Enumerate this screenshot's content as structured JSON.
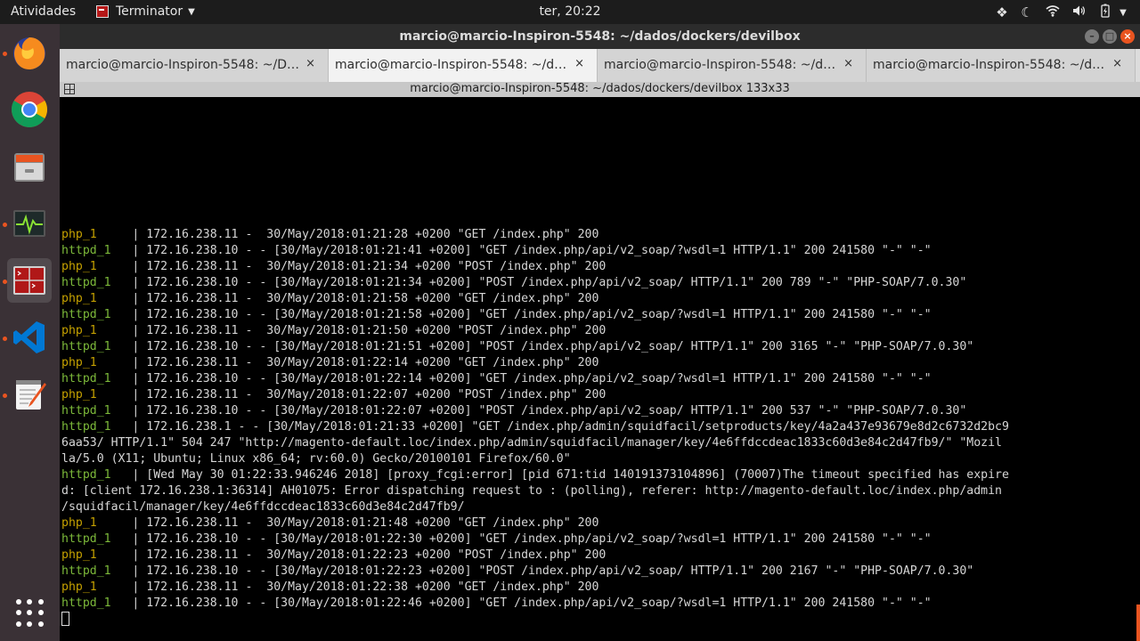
{
  "topbar": {
    "activities": "Atividades",
    "app_name": "Terminator",
    "clock": "ter, 20:22"
  },
  "window": {
    "title": "marcio@marcio-Inspiron-5548: ~/dados/dockers/devilbox"
  },
  "tabs": [
    {
      "label": "marcio@marcio-Inspiron-5548: ~/Do...",
      "active": false
    },
    {
      "label": "marcio@marcio-Inspiron-5548: ~/da...",
      "active": true
    },
    {
      "label": "marcio@marcio-Inspiron-5548: ~/da...",
      "active": false
    },
    {
      "label": "marcio@marcio-Inspiron-5548: ~/da...",
      "active": false
    }
  ],
  "tab_close": "×",
  "terminal": {
    "header": "marcio@marcio-Inspiron-5548: ~/dados/dockers/devilbox 133x33",
    "lines": [
      {
        "svc": "php_1     ",
        "text": "| 172.16.238.11 -  30/May/2018:01:21:28 +0200 \"GET /index.php\" 200"
      },
      {
        "svc": "httpd_1   ",
        "text": "| 172.16.238.10 - - [30/May/2018:01:21:41 +0200] \"GET /index.php/api/v2_soap/?wsdl=1 HTTP/1.1\" 200 241580 \"-\" \"-\""
      },
      {
        "svc": "php_1     ",
        "text": "| 172.16.238.11 -  30/May/2018:01:21:34 +0200 \"POST /index.php\" 200"
      },
      {
        "svc": "httpd_1   ",
        "text": "| 172.16.238.10 - - [30/May/2018:01:21:34 +0200] \"POST /index.php/api/v2_soap/ HTTP/1.1\" 200 789 \"-\" \"PHP-SOAP/7.0.30\""
      },
      {
        "svc": "php_1     ",
        "text": "| 172.16.238.11 -  30/May/2018:01:21:58 +0200 \"GET /index.php\" 200"
      },
      {
        "svc": "httpd_1   ",
        "text": "| 172.16.238.10 - - [30/May/2018:01:21:58 +0200] \"GET /index.php/api/v2_soap/?wsdl=1 HTTP/1.1\" 200 241580 \"-\" \"-\""
      },
      {
        "svc": "php_1     ",
        "text": "| 172.16.238.11 -  30/May/2018:01:21:50 +0200 \"POST /index.php\" 200"
      },
      {
        "svc": "httpd_1   ",
        "text": "| 172.16.238.10 - - [30/May/2018:01:21:51 +0200] \"POST /index.php/api/v2_soap/ HTTP/1.1\" 200 3165 \"-\" \"PHP-SOAP/7.0.30\""
      },
      {
        "svc": "php_1     ",
        "text": "| 172.16.238.11 -  30/May/2018:01:22:14 +0200 \"GET /index.php\" 200"
      },
      {
        "svc": "httpd_1   ",
        "text": "| 172.16.238.10 - - [30/May/2018:01:22:14 +0200] \"GET /index.php/api/v2_soap/?wsdl=1 HTTP/1.1\" 200 241580 \"-\" \"-\""
      },
      {
        "svc": "php_1     ",
        "text": "| 172.16.238.11 -  30/May/2018:01:22:07 +0200 \"POST /index.php\" 200"
      },
      {
        "svc": "httpd_1   ",
        "text": "| 172.16.238.10 - - [30/May/2018:01:22:07 +0200] \"POST /index.php/api/v2_soap/ HTTP/1.1\" 200 537 \"-\" \"PHP-SOAP/7.0.30\""
      },
      {
        "svc": "httpd_1   ",
        "text": "| 172.16.238.1 - - [30/May/2018:01:21:33 +0200] \"GET /index.php/admin/squidfacil/setproducts/key/4a2a437e93679e8d2c6732d2bc9"
      },
      {
        "svc": "",
        "text": "6aa53/ HTTP/1.1\" 504 247 \"http://magento-default.loc/index.php/admin/squidfacil/manager/key/4e6ffdccdeac1833c60d3e84c2d47fb9/\" \"Mozil"
      },
      {
        "svc": "",
        "text": "la/5.0 (X11; Ubuntu; Linux x86_64; rv:60.0) Gecko/20100101 Firefox/60.0\""
      },
      {
        "svc": "httpd_1   ",
        "text": "| [Wed May 30 01:22:33.946246 2018] [proxy_fcgi:error] [pid 671:tid 140191373104896] (70007)The timeout specified has expire"
      },
      {
        "svc": "",
        "text": "d: [client 172.16.238.1:36314] AH01075: Error dispatching request to : (polling), referer: http://magento-default.loc/index.php/admin"
      },
      {
        "svc": "",
        "text": "/squidfacil/manager/key/4e6ffdccdeac1833c60d3e84c2d47fb9/"
      },
      {
        "svc": "php_1     ",
        "text": "| 172.16.238.11 -  30/May/2018:01:21:48 +0200 \"GET /index.php\" 200"
      },
      {
        "svc": "httpd_1   ",
        "text": "| 172.16.238.10 - - [30/May/2018:01:22:30 +0200] \"GET /index.php/api/v2_soap/?wsdl=1 HTTP/1.1\" 200 241580 \"-\" \"-\""
      },
      {
        "svc": "php_1     ",
        "text": "| 172.16.238.11 -  30/May/2018:01:22:23 +0200 \"POST /index.php\" 200"
      },
      {
        "svc": "httpd_1   ",
        "text": "| 172.16.238.10 - - [30/May/2018:01:22:23 +0200] \"POST /index.php/api/v2_soap/ HTTP/1.1\" 200 2167 \"-\" \"PHP-SOAP/7.0.30\""
      },
      {
        "svc": "php_1     ",
        "text": "| 172.16.238.11 -  30/May/2018:01:22:38 +0200 \"GET /index.php\" 200"
      },
      {
        "svc": "httpd_1   ",
        "text": "| 172.16.238.10 - - [30/May/2018:01:22:46 +0200] \"GET /index.php/api/v2_soap/?wsdl=1 HTTP/1.1\" 200 241580 \"-\" \"-\""
      }
    ]
  },
  "dock": [
    {
      "icon": "firefox-icon",
      "running": true
    },
    {
      "icon": "chrome-icon",
      "running": false
    },
    {
      "icon": "files-icon",
      "running": false
    },
    {
      "icon": "system-monitor-icon",
      "running": true
    },
    {
      "icon": "terminator-icon",
      "running": true
    },
    {
      "icon": "vscode-icon",
      "running": true
    },
    {
      "icon": "text-editor-icon",
      "running": true
    },
    {
      "icon": "show-applications-icon",
      "running": false
    }
  ],
  "colors": {
    "php_service": "#c4a000",
    "httpd_service": "#7dba3a",
    "accent": "#e95420",
    "dock_bg": "#3a3136"
  }
}
